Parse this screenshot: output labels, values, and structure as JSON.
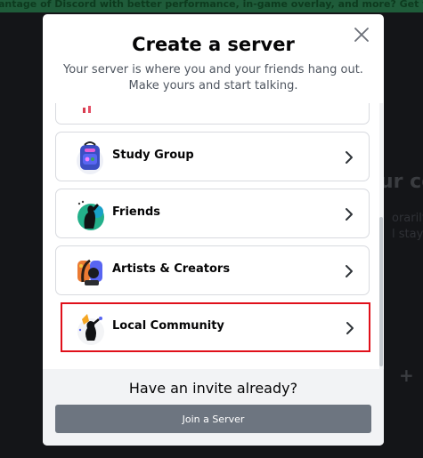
{
  "background": {
    "banner_text": "antage of Discord with better performance, in-game overlay, and more? Get the desktop app",
    "title_fragment": "ur co",
    "line_fragments": [
      "orarily",
      "l stay c"
    ]
  },
  "modal": {
    "title": "Create a server",
    "subtitle": "Your server is where you and your friends hang out. Make yours and start talking.",
    "templates": [
      {
        "label": "Study Group"
      },
      {
        "label": "Friends"
      },
      {
        "label": "Artists & Creators"
      },
      {
        "label": "Local Community"
      }
    ],
    "footer": {
      "heading": "Have an invite already?",
      "join_button": "Join a Server"
    }
  },
  "colors": {
    "highlight": "#e0101a",
    "join_button": "#6d7580"
  },
  "icons": [
    "close-icon",
    "chevron-right-icon",
    "study-group-icon",
    "friends-icon",
    "artists-creators-icon",
    "local-community-icon"
  ]
}
